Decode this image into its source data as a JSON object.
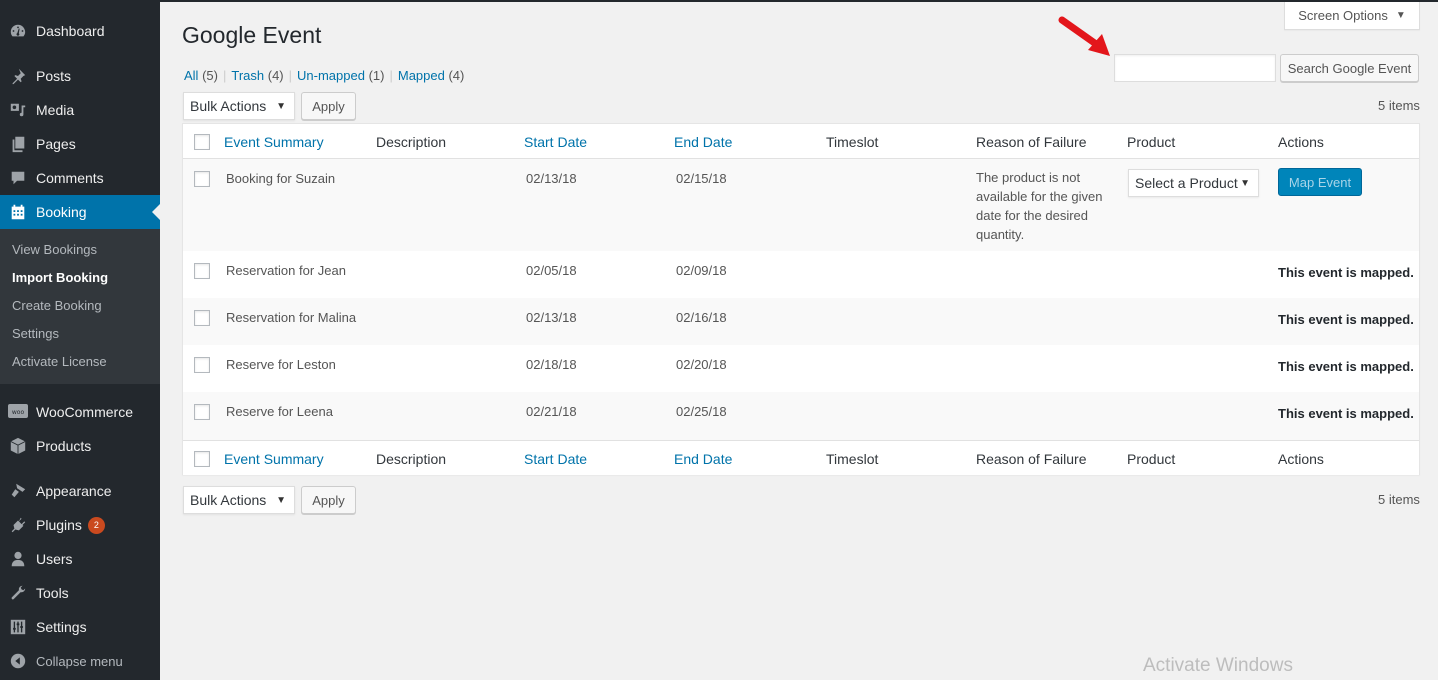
{
  "sidebar": {
    "items": [
      {
        "label": "Dashboard",
        "icon": "dashboard-icon"
      },
      {
        "label": "Posts",
        "icon": "pushpin-icon"
      },
      {
        "label": "Media",
        "icon": "media-icon"
      },
      {
        "label": "Pages",
        "icon": "pages-icon"
      },
      {
        "label": "Comments",
        "icon": "comment-icon"
      },
      {
        "label": "Booking",
        "icon": "calendar-icon",
        "active": true
      },
      {
        "label": "WooCommerce",
        "icon": "woo-icon"
      },
      {
        "label": "Products",
        "icon": "box-icon"
      },
      {
        "label": "Appearance",
        "icon": "paintbrush-icon"
      },
      {
        "label": "Plugins",
        "icon": "plugin-icon",
        "badge": "2"
      },
      {
        "label": "Users",
        "icon": "user-icon"
      },
      {
        "label": "Tools",
        "icon": "wrench-icon"
      },
      {
        "label": "Settings",
        "icon": "sliders-icon"
      }
    ],
    "submenu": [
      "View Bookings",
      "Import Booking",
      "Create Booking",
      "Settings",
      "Activate License"
    ],
    "current_submenu": "Import Booking",
    "collapse_label": "Collapse menu"
  },
  "header": {
    "screen_options": "Screen Options",
    "title": "Google Event"
  },
  "filters": [
    {
      "label": "All",
      "count": "(5)"
    },
    {
      "label": "Trash",
      "count": "(4)"
    },
    {
      "label": "Un-mapped",
      "count": "(1)"
    },
    {
      "label": "Mapped",
      "count": "(4)"
    }
  ],
  "search": {
    "value": "",
    "placeholder": "",
    "button": "Search Google Event"
  },
  "bulk": {
    "selected": "Bulk Actions",
    "apply": "Apply"
  },
  "items_count": "5 items",
  "table": {
    "columns": [
      "Event Summary",
      "Description",
      "Start Date",
      "End Date",
      "Timeslot",
      "Reason of Failure",
      "Product",
      "Actions"
    ],
    "rows": [
      {
        "summary": "Booking for Suzain",
        "description": "",
        "start": "02/13/18",
        "end": "02/15/18",
        "timeslot": "",
        "reason": "The product is not available for the given date for the desired quantity.",
        "product": "Select a Product",
        "action": "Map Event"
      },
      {
        "summary": "Reservation for Jean",
        "description": "",
        "start": "02/05/18",
        "end": "02/09/18",
        "timeslot": "",
        "reason": "",
        "product": "",
        "action": "This event is mapped."
      },
      {
        "summary": "Reservation for Malina",
        "description": "",
        "start": "02/13/18",
        "end": "02/16/18",
        "timeslot": "",
        "reason": "",
        "product": "",
        "action": "This event is mapped."
      },
      {
        "summary": "Reserve for Leston",
        "description": "",
        "start": "02/18/18",
        "end": "02/20/18",
        "timeslot": "",
        "reason": "",
        "product": "",
        "action": "This event is mapped."
      },
      {
        "summary": "Reserve for Leena",
        "description": "",
        "start": "02/21/18",
        "end": "02/25/18",
        "timeslot": "",
        "reason": "",
        "product": "",
        "action": "This event is mapped."
      }
    ]
  },
  "watermark": "Activate Windows",
  "colors": {
    "accent": "#0073aa",
    "sidebar": "#23282d",
    "badge": "#ca4a1f",
    "primary_button": "#0085ba"
  }
}
